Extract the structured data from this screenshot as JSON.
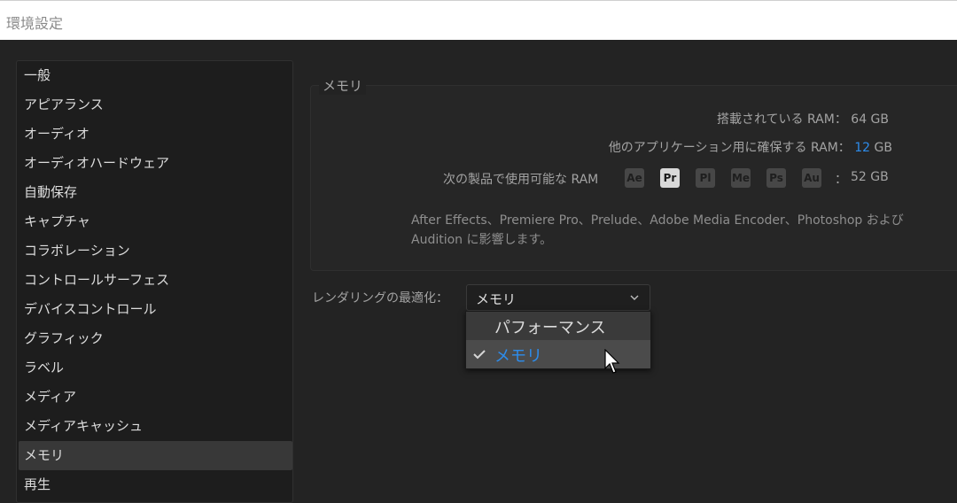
{
  "window": {
    "title": "環境設定"
  },
  "sidebar": {
    "items": [
      {
        "label": "一般"
      },
      {
        "label": "アピアランス"
      },
      {
        "label": "オーディオ"
      },
      {
        "label": "オーディオハードウェア"
      },
      {
        "label": "自動保存"
      },
      {
        "label": "キャプチャ"
      },
      {
        "label": "コラボレーション"
      },
      {
        "label": "コントロールサーフェス"
      },
      {
        "label": "デバイスコントロール"
      },
      {
        "label": "グラフィック"
      },
      {
        "label": "ラベル"
      },
      {
        "label": "メディア"
      },
      {
        "label": "メディアキャッシュ"
      },
      {
        "label": "メモリ"
      },
      {
        "label": "再生"
      }
    ],
    "selected": "メモリ"
  },
  "memory": {
    "legend": "メモリ",
    "installed_label": "搭載されている RAM：",
    "installed_value": "64 GB",
    "reserved_label": "他のアプリケーション用に確保する RAM：",
    "reserved_value": "12",
    "reserved_unit": "GB",
    "available_label": "次の製品で使用可能な RAM",
    "apps": [
      "Ae",
      "Pr",
      "Pl",
      "Me",
      "Ps",
      "Au"
    ],
    "active_app": "Pr",
    "available_sep": "：",
    "available_value": "52 GB",
    "note_line1": "After Effects、Premiere Pro、Prelude、Adobe Media Encoder、Photoshop および",
    "note_line2": "Audition に影響します。"
  },
  "render": {
    "label": "レンダリングの最適化：",
    "selected": "メモリ",
    "options": [
      {
        "label": "パフォーマンス",
        "checked": false
      },
      {
        "label": "メモリ",
        "checked": true
      }
    ]
  },
  "colors": {
    "accent": "#2d8ceb",
    "background": "#232323",
    "sidebar_selected": "#383838"
  },
  "icons": {
    "dropdown": "chevron-down-icon",
    "checked": "checkmark-icon",
    "cursor": "mouse-pointer-icon"
  }
}
